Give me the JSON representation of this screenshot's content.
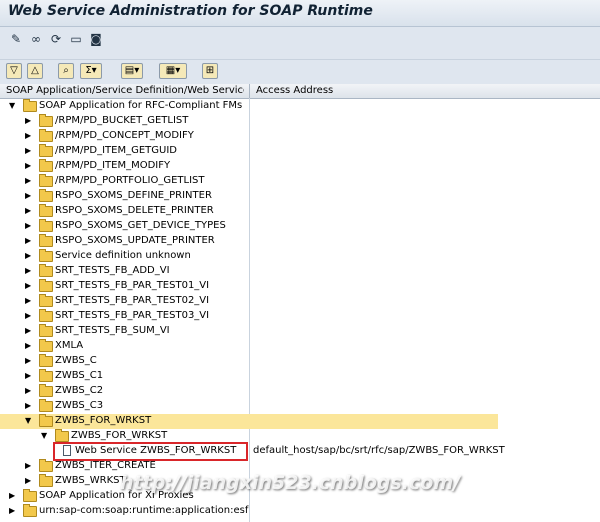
{
  "window": {
    "title": "Web Service Administration for SOAP Runtime"
  },
  "toolbar1": {
    "icons": [
      "pencil-icon",
      "glasses-icon",
      "refresh-icon",
      "window-icon",
      "display-icon"
    ]
  },
  "toolbar2": {
    "icons": [
      "expand-icon",
      "collapse-icon",
      "find-icon",
      "sum-icon",
      "layout-icon",
      "table-icon",
      "hierarchy-icon"
    ]
  },
  "grid": {
    "headers": {
      "col1": "SOAP Application/Service Definition/Web Service ...",
      "col2": "Access Address"
    },
    "rows": [
      {
        "label": "SOAP Application for RFC-Compliant FMs",
        "level": 0,
        "expanded": true,
        "icon": "folder"
      },
      {
        "label": "/RPM/PD_BUCKET_GETLIST",
        "level": 1,
        "icon": "folder"
      },
      {
        "label": "/RPM/PD_CONCEPT_MODIFY",
        "level": 1,
        "icon": "folder"
      },
      {
        "label": "/RPM/PD_ITEM_GETGUID",
        "level": 1,
        "icon": "folder"
      },
      {
        "label": "/RPM/PD_ITEM_MODIFY",
        "level": 1,
        "icon": "folder"
      },
      {
        "label": "/RPM/PD_PORTFOLIO_GETLIST",
        "level": 1,
        "icon": "folder"
      },
      {
        "label": "RSPO_SXOMS_DEFINE_PRINTER",
        "level": 1,
        "icon": "folder"
      },
      {
        "label": "RSPO_SXOMS_DELETE_PRINTER",
        "level": 1,
        "icon": "folder"
      },
      {
        "label": "RSPO_SXOMS_GET_DEVICE_TYPES",
        "level": 1,
        "icon": "folder"
      },
      {
        "label": "RSPO_SXOMS_UPDATE_PRINTER",
        "level": 1,
        "icon": "folder"
      },
      {
        "label": "Service definition unknown",
        "level": 1,
        "icon": "folder"
      },
      {
        "label": "SRT_TESTS_FB_ADD_VI",
        "level": 1,
        "icon": "folder"
      },
      {
        "label": "SRT_TESTS_FB_PAR_TEST01_VI",
        "level": 1,
        "icon": "folder"
      },
      {
        "label": "SRT_TESTS_FB_PAR_TEST02_VI",
        "level": 1,
        "icon": "folder"
      },
      {
        "label": "SRT_TESTS_FB_PAR_TEST03_VI",
        "level": 1,
        "icon": "folder"
      },
      {
        "label": "SRT_TESTS_FB_SUM_VI",
        "level": 1,
        "icon": "folder"
      },
      {
        "label": "XMLA",
        "level": 1,
        "icon": "folder"
      },
      {
        "label": "ZWBS_C",
        "level": 1,
        "icon": "folder"
      },
      {
        "label": "ZWBS_C1",
        "level": 1,
        "icon": "folder"
      },
      {
        "label": "ZWBS_C2",
        "level": 1,
        "icon": "folder"
      },
      {
        "label": "ZWBS_C3",
        "level": 1,
        "icon": "folder"
      },
      {
        "label": "ZWBS_FOR_WRKST",
        "level": 1,
        "expanded": true,
        "icon": "folder",
        "selected": true
      },
      {
        "label": "ZWBS_FOR_WRKST",
        "level": 2,
        "expanded": true,
        "icon": "folder"
      },
      {
        "label": "Web Service ZWBS_FOR_WRKST",
        "level": 3,
        "icon": "doc",
        "address": "default_host/sap/bc/srt/rfc/sap/ZWBS_FOR_WRKST",
        "highlighted": true
      },
      {
        "label": "ZWBS_ITER_CREATE",
        "level": 1,
        "icon": "folder"
      },
      {
        "label": "ZWBS_WRKST",
        "level": 1,
        "icon": "folder"
      },
      {
        "label": "SOAP Application for XI Proxies",
        "level": 0,
        "icon": "folder"
      },
      {
        "label": "urn:sap-com:soap:runtime:application:esf",
        "level": 0,
        "icon": "folder"
      }
    ]
  },
  "watermark": "http://jiangxin523.cnblogs.com/",
  "colors": {
    "selected_row": "#fbe69a",
    "highlight_border": "#d9262a",
    "folder": "#f2c84b"
  }
}
